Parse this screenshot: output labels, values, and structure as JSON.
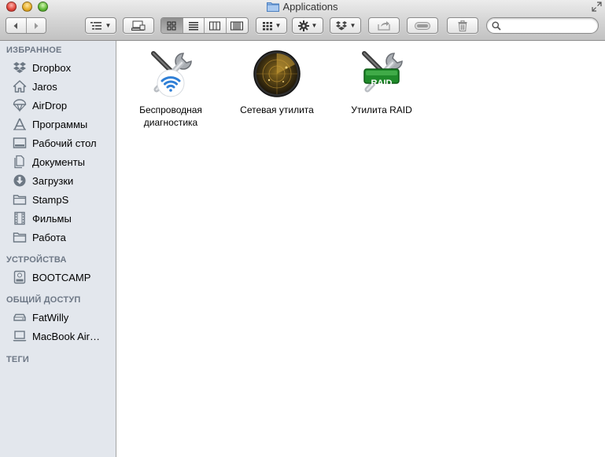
{
  "window": {
    "title": "Applications"
  },
  "toolbar": {
    "colors": {
      "accent": "#3a7fd5"
    }
  },
  "sidebar": {
    "sections": [
      {
        "heading": "ИЗБРАННОЕ",
        "items": [
          {
            "label": "Dropbox",
            "icon": "dropbox-icon"
          },
          {
            "label": "Jaros",
            "icon": "home-icon"
          },
          {
            "label": "AirDrop",
            "icon": "airdrop-icon"
          },
          {
            "label": "Программы",
            "icon": "applications-icon"
          },
          {
            "label": "Рабочий стол",
            "icon": "desktop-icon"
          },
          {
            "label": "Документы",
            "icon": "documents-icon"
          },
          {
            "label": "Загрузки",
            "icon": "downloads-icon"
          },
          {
            "label": "StampS",
            "icon": "folder-icon"
          },
          {
            "label": "Фильмы",
            "icon": "movies-icon"
          },
          {
            "label": "Работа",
            "icon": "folder-icon"
          }
        ]
      },
      {
        "heading": "УСТРОЙСТВА",
        "items": [
          {
            "label": "BOOTCAMP",
            "icon": "drive-icon"
          }
        ]
      },
      {
        "heading": "ОБЩИЙ ДОСТУП",
        "items": [
          {
            "label": "FatWilly",
            "icon": "server-icon"
          },
          {
            "label": "MacBook Air…",
            "icon": "laptop-icon"
          }
        ]
      },
      {
        "heading": "ТЕГИ",
        "items": []
      }
    ]
  },
  "content": {
    "items": [
      {
        "label": "Беспроводная диагностика",
        "icon": "wireless-diagnostics-icon"
      },
      {
        "label": "Сетевая утилита",
        "icon": "network-utility-icon"
      },
      {
        "label": "Утилита RAID",
        "icon": "raid-utility-icon",
        "badge": "RAID"
      }
    ]
  },
  "search": {
    "value": "",
    "placeholder": ""
  }
}
